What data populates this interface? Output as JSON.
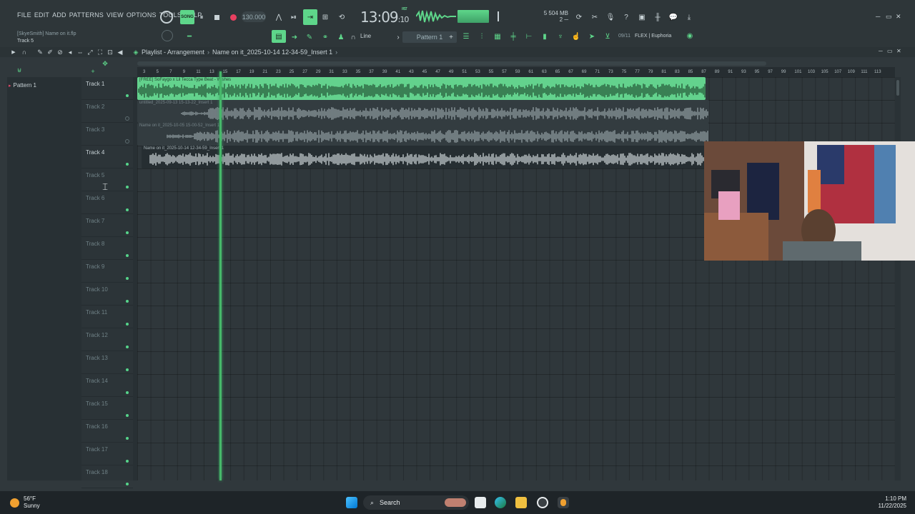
{
  "menu": [
    "FILE",
    "EDIT",
    "ADD",
    "PATTERNS",
    "VIEW",
    "OPTIONS",
    "TOOLS",
    "HELP"
  ],
  "song": {
    "line1": "[SkyeSmith] Name on it.flp",
    "line2": "Track 5"
  },
  "transport": {
    "mode": "SONG",
    "tempo": "130.000"
  },
  "clock": {
    "main": "13:09",
    "sub": "10",
    "tag": "RST"
  },
  "memory": {
    "line1": "5     504 MB",
    "line2": "2 ─"
  },
  "toolbar2": {
    "snap": "Line",
    "pattern": "Pattern 1"
  },
  "plugin": {
    "num": "09/11",
    "name": "FLEX | Euphoria"
  },
  "playlist": {
    "title": "Playlist - Arrangement",
    "project": "Name on it_2025-10-14 12-34-59_Insert 1"
  },
  "picker": {
    "item": "Pattern 1"
  },
  "ruler": [
    "3",
    "5",
    "7",
    "9",
    "11",
    "13",
    "15",
    "17",
    "19",
    "21",
    "23",
    "25",
    "27",
    "29",
    "31",
    "33",
    "35",
    "37",
    "39",
    "41",
    "43",
    "45",
    "47",
    "49",
    "51",
    "53",
    "55",
    "57",
    "59",
    "61",
    "63",
    "65",
    "67",
    "69",
    "71",
    "73",
    "75",
    "77",
    "79",
    "81",
    "83",
    "85",
    "87",
    "89",
    "91",
    "93",
    "95",
    "97",
    "99",
    "101",
    "103",
    "105",
    "107",
    "109",
    "111",
    "113"
  ],
  "tracks": [
    {
      "name": "Track 1",
      "active": true
    },
    {
      "name": "Track 2",
      "active": false
    },
    {
      "name": "Track 3",
      "active": false
    },
    {
      "name": "Track 4",
      "active": true
    },
    {
      "name": "Track 5",
      "active": false
    },
    {
      "name": "Track 6",
      "active": false
    },
    {
      "name": "Track 7",
      "active": false
    },
    {
      "name": "Track 8",
      "active": false
    },
    {
      "name": "Track 9",
      "active": false
    },
    {
      "name": "Track 10",
      "active": false
    },
    {
      "name": "Track 11",
      "active": false
    },
    {
      "name": "Track 12",
      "active": false
    },
    {
      "name": "Track 13",
      "active": false
    },
    {
      "name": "Track 14",
      "active": false
    },
    {
      "name": "Track 15",
      "active": false
    },
    {
      "name": "Track 16",
      "active": false
    },
    {
      "name": "Track 17",
      "active": false
    },
    {
      "name": "Track 18",
      "active": false
    }
  ],
  "clips": [
    {
      "title": "[FREE] SoFaygo x Lil Tecca Type Beat - Wishes",
      "style": "green"
    },
    {
      "title": "untitled_2025-09-13 15-13-22_Insert 1",
      "style": "grey"
    },
    {
      "title": "Name on it_2025-10-05 15-00-52_Insert 1",
      "style": "grey"
    },
    {
      "title": "Name on it_2025-10-14 12-34-59_Insert 1",
      "style": "dark"
    }
  ],
  "taskbar": {
    "temp": "56°F",
    "condition": "Sunny",
    "search": "Search",
    "time": "1:10 PM",
    "date": "11/22/2025"
  },
  "colors": {
    "accent": "#5ed68a",
    "clip_green": "#63d28d",
    "background": "#30383c"
  }
}
